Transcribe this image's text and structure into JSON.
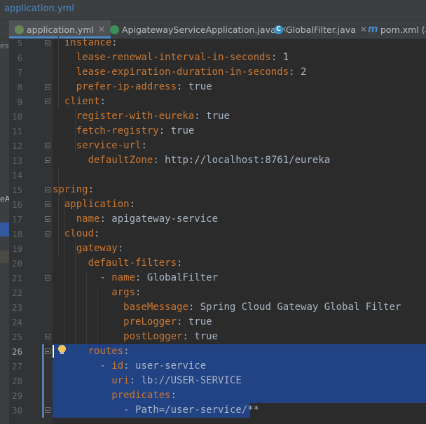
{
  "titlebar": {
    "path": "application.yml"
  },
  "tabs": [
    {
      "label": "application.yml",
      "icon": "yaml-file-icon",
      "active": true
    },
    {
      "label": "ApigatewayServiceApplication.java",
      "icon": "spring-class-icon",
      "active": false
    },
    {
      "label": "GlobalFilter.java",
      "icon": "class-icon",
      "active": false
    },
    {
      "label": "pom.xml (ap",
      "icon": "maven-icon",
      "active": false
    }
  ],
  "close_glyph": "✕",
  "left_strip": {
    "frag1": "esh",
    "frag2": "eAp"
  },
  "editor": {
    "current_line": 26,
    "lines": [
      {
        "n": 5,
        "indent": "  ",
        "key": "instance",
        "val": ""
      },
      {
        "n": 6,
        "indent": "    ",
        "key": "lease-renewal-interval-in-seconds",
        "val": " 1"
      },
      {
        "n": 7,
        "indent": "    ",
        "key": "lease-expiration-duration-in-seconds",
        "val": " 2"
      },
      {
        "n": 8,
        "indent": "    ",
        "key": "prefer-ip-address",
        "val": " true"
      },
      {
        "n": 9,
        "indent": "  ",
        "key": "client",
        "val": ""
      },
      {
        "n": 10,
        "indent": "    ",
        "key": "register-with-eureka",
        "val": " true"
      },
      {
        "n": 11,
        "indent": "    ",
        "key": "fetch-registry",
        "val": " true"
      },
      {
        "n": 12,
        "indent": "    ",
        "key": "service-url",
        "val": ""
      },
      {
        "n": 13,
        "indent": "      ",
        "key": "defaultZone",
        "val": " http://localhost:8761/eureka"
      },
      {
        "n": 14,
        "indent": "",
        "key": "",
        "val": ""
      },
      {
        "n": 15,
        "indent": "",
        "key": "spring",
        "val": ""
      },
      {
        "n": 16,
        "indent": "  ",
        "key": "application",
        "val": ""
      },
      {
        "n": 17,
        "indent": "    ",
        "key": "name",
        "val": " apigateway-service"
      },
      {
        "n": 18,
        "indent": "  ",
        "key": "cloud",
        "val": ""
      },
      {
        "n": 19,
        "indent": "    ",
        "key": "gateway",
        "val": ""
      },
      {
        "n": 20,
        "indent": "      ",
        "key": "default-filters",
        "val": ""
      },
      {
        "n": 21,
        "indent": "        - ",
        "key": "name",
        "val": " GlobalFilter"
      },
      {
        "n": 22,
        "indent": "          ",
        "key": "args",
        "val": ""
      },
      {
        "n": 23,
        "indent": "            ",
        "key": "baseMessage",
        "val": " Spring Cloud Gateway Global Filter"
      },
      {
        "n": 24,
        "indent": "            ",
        "key": "preLogger",
        "val": " true"
      },
      {
        "n": 25,
        "indent": "            ",
        "key": "postLogger",
        "val": " true"
      },
      {
        "n": 26,
        "indent": "      ",
        "key": "routes",
        "val": ""
      },
      {
        "n": 27,
        "indent": "        - ",
        "key": "id",
        "val": " user-service"
      },
      {
        "n": 28,
        "indent": "          ",
        "key": "uri",
        "val": " lb://USER-SERVICE"
      },
      {
        "n": 29,
        "indent": "          ",
        "key": "predicates",
        "val": ""
      },
      {
        "n": 30,
        "indent": "            - ",
        "key": "",
        "val": "Path=/user-service/**"
      }
    ]
  },
  "colors": {
    "key": "#cc7832",
    "value": "#a9b7c6",
    "selection": "#214283",
    "background": "#2b2b2b",
    "gutter": "#313335"
  }
}
